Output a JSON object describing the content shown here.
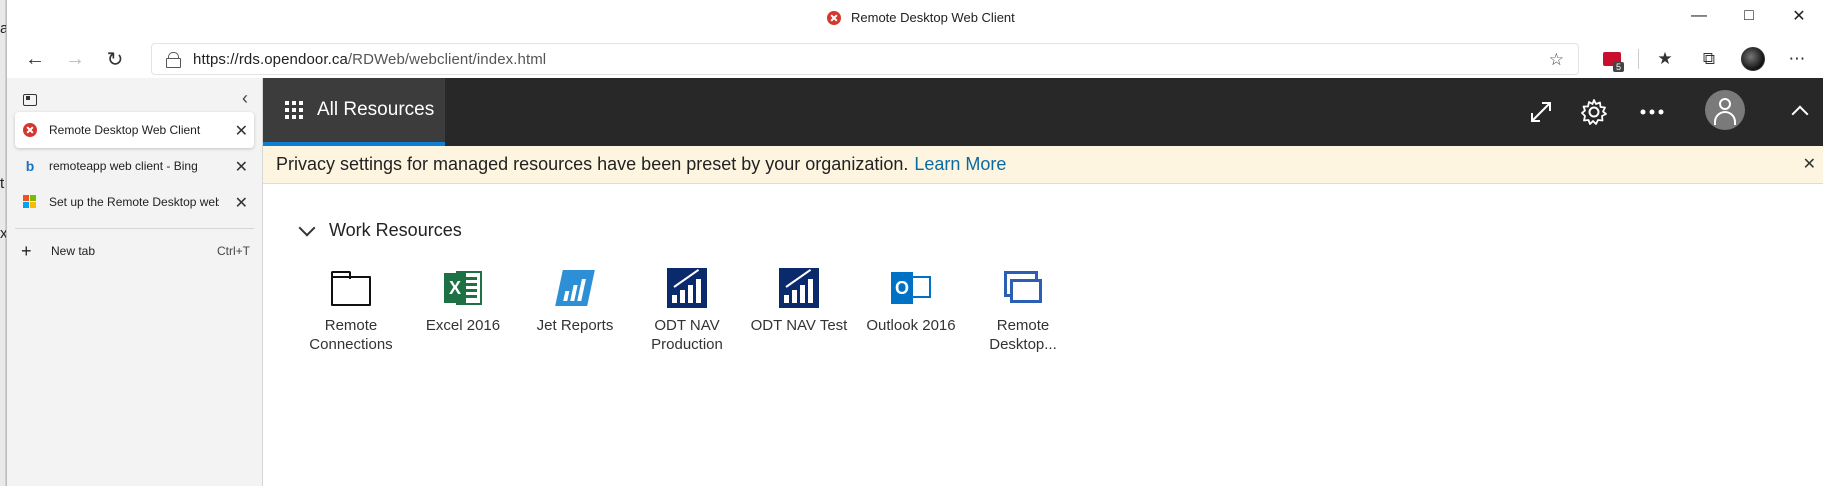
{
  "browser": {
    "window_title": "Remote Desktop Web Client",
    "url_host": "https://rds.opendoor.ca",
    "url_path": "/RDWeb/webclient/index.html",
    "extension_badge": "5"
  },
  "tabs_panel": {
    "tabs": [
      {
        "label": "Remote Desktop Web Client",
        "icon": "remote-desktop-icon",
        "active": true
      },
      {
        "label": "remoteapp web client - Bing",
        "icon": "bing-icon",
        "active": false
      },
      {
        "label": "Set up the Remote Desktop web",
        "icon": "microsoft-logo-icon",
        "active": false
      }
    ],
    "new_tab_label": "New tab",
    "new_tab_shortcut": "Ctrl+T"
  },
  "app": {
    "header": {
      "all_resources_label": "All Resources"
    },
    "banner": {
      "text": "Privacy settings for managed resources have been preset by your organization.",
      "link": "Learn More"
    },
    "section_title": "Work Resources",
    "resources": [
      {
        "label": "Remote Connections",
        "icon": "folder-icon"
      },
      {
        "label": "Excel 2016",
        "icon": "excel-icon"
      },
      {
        "label": "Jet Reports",
        "icon": "jet-reports-icon"
      },
      {
        "label": "ODT NAV Production",
        "icon": "odt-nav-icon"
      },
      {
        "label": "ODT NAV Test",
        "icon": "odt-nav-icon"
      },
      {
        "label": "Outlook 2016",
        "icon": "outlook-icon"
      },
      {
        "label": "Remote Desktop...",
        "icon": "remote-desktop-connection-icon"
      }
    ]
  },
  "colors": {
    "header_bg": "#282828",
    "accent": "#0f7fd6",
    "banner_bg": "#fdf5e0",
    "link": "#0b6aa2"
  }
}
